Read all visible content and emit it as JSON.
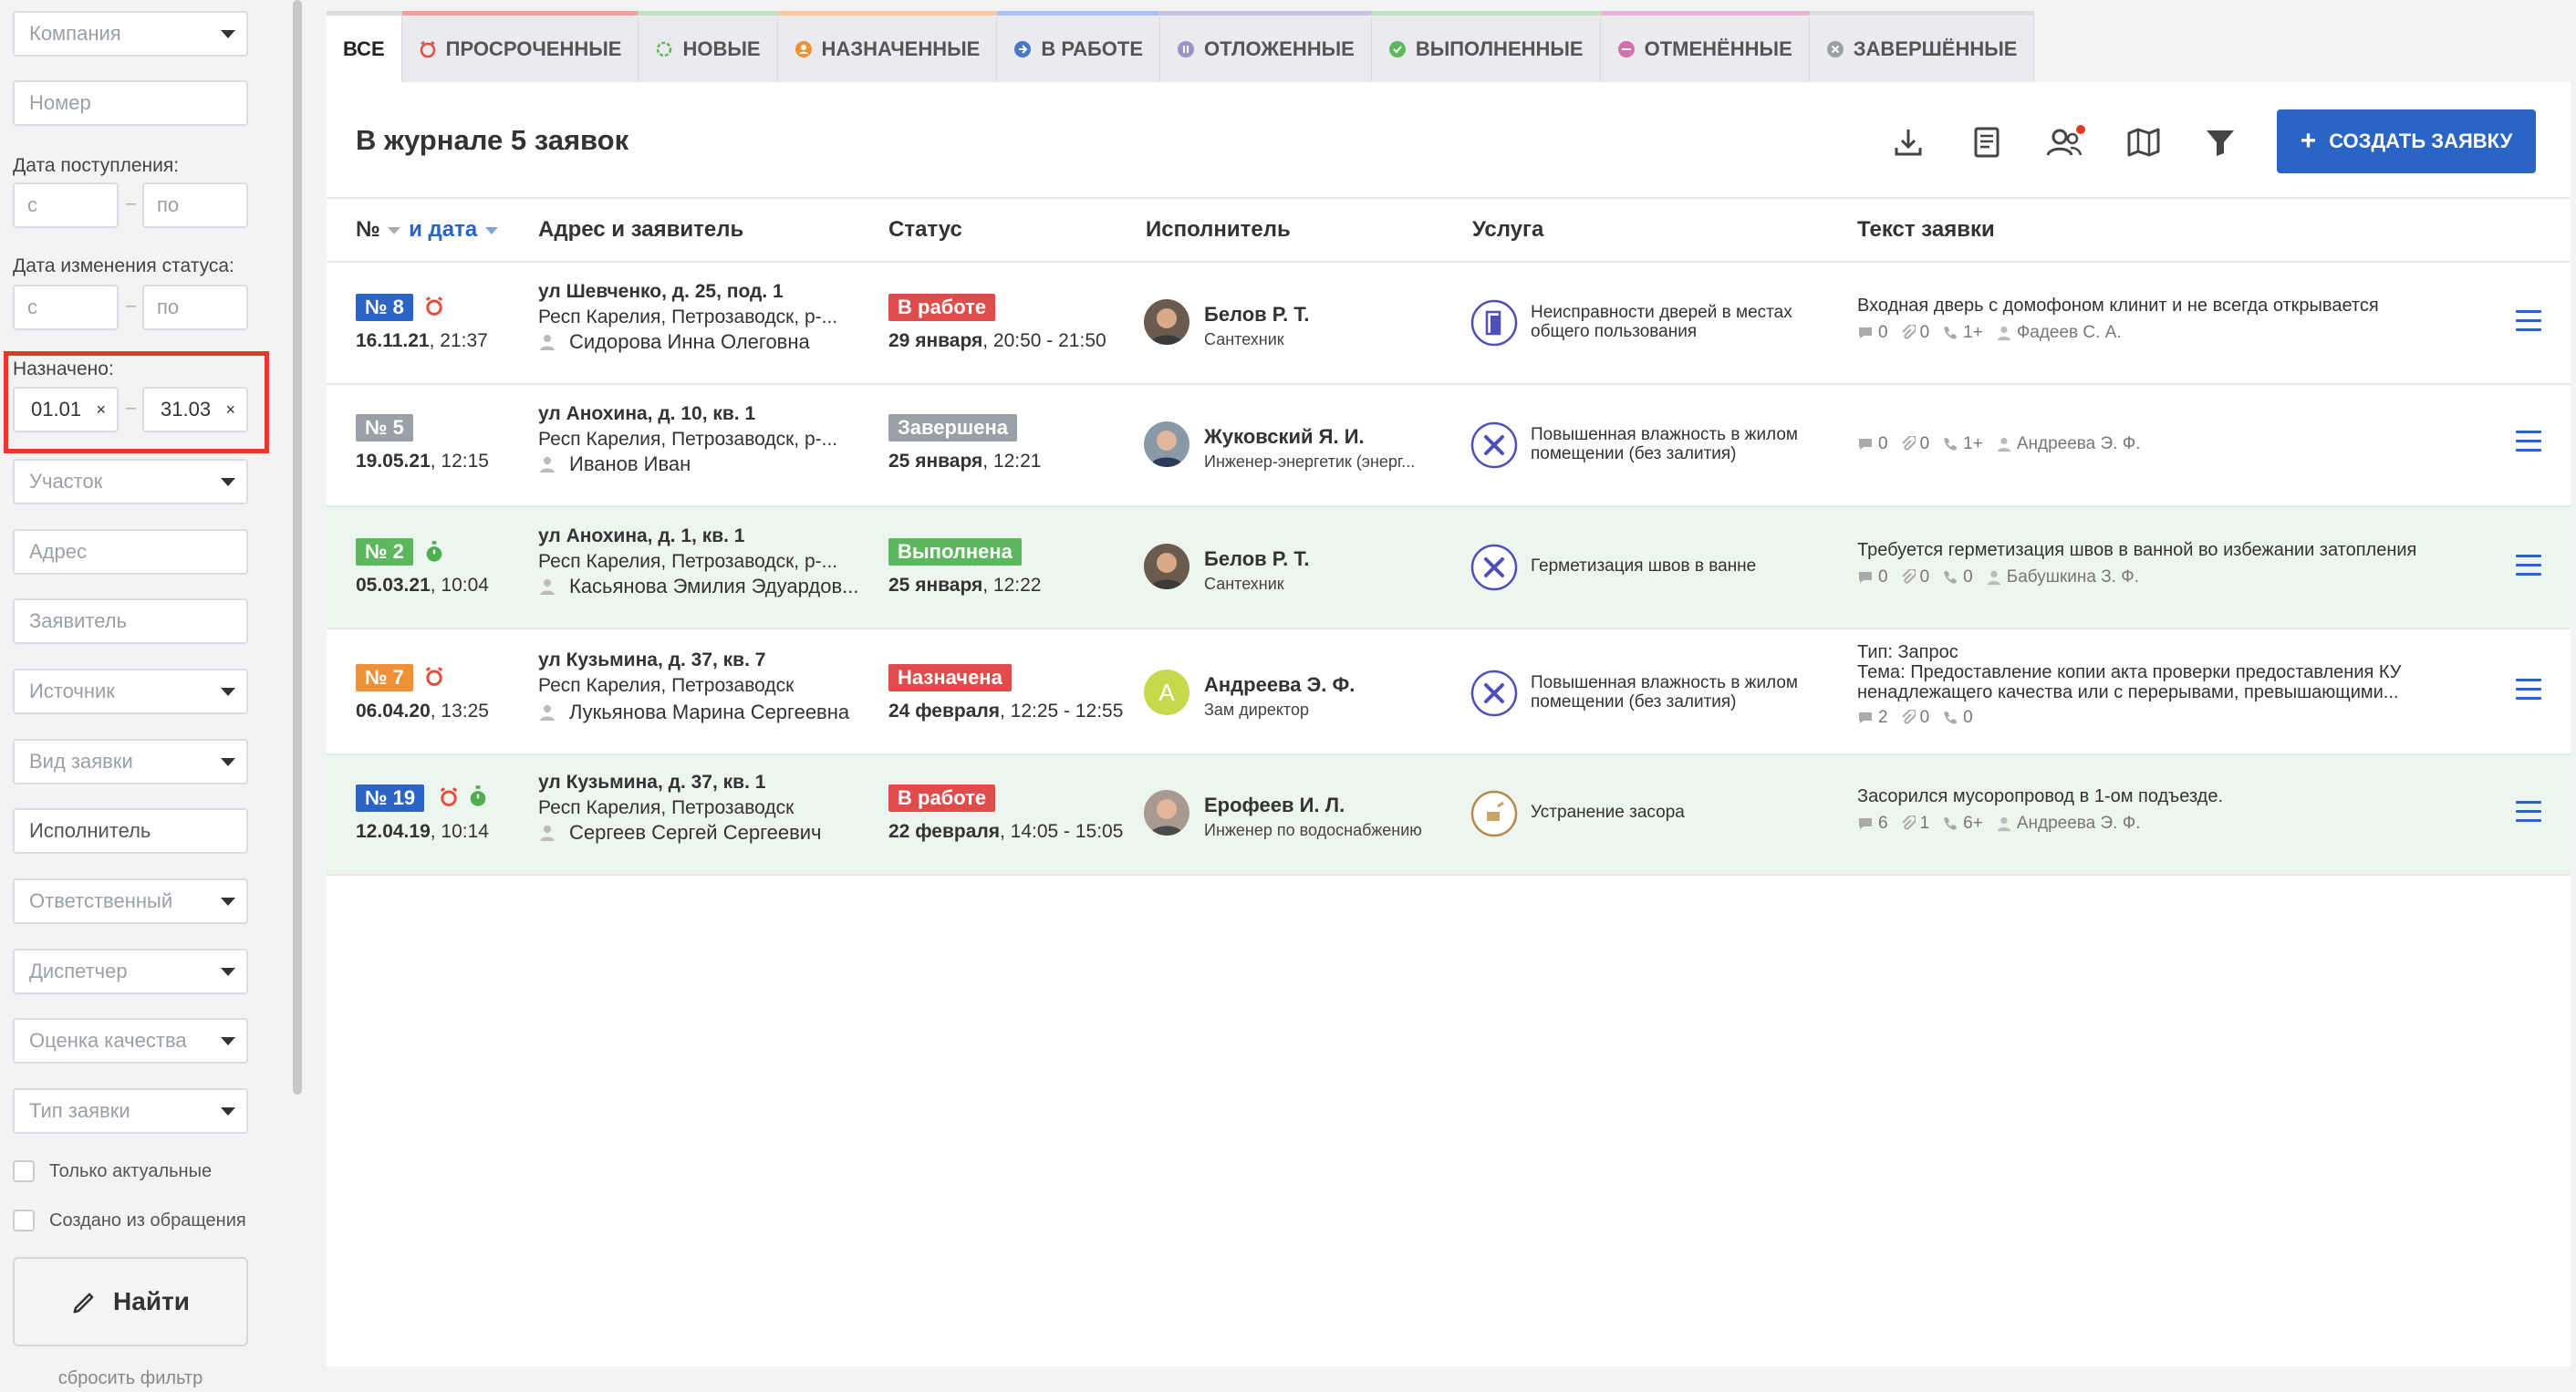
{
  "sidebar": {
    "company_placeholder": "Компания",
    "number_placeholder": "Номер",
    "date_received_label": "Дата поступления:",
    "from_placeholder": "с",
    "to_placeholder": "по",
    "status_change_label": "Дата изменения статуса:",
    "assigned_label": "Назначено:",
    "assigned_from": "01.01",
    "assigned_to": "31.03",
    "clear_symbol": "×",
    "area_placeholder": "Участок",
    "address_placeholder": "Адрес",
    "applicant_placeholder": "Заявитель",
    "source_placeholder": "Источник",
    "request_kind_placeholder": "Вид заявки",
    "executor_placeholder": "Исполнитель",
    "responsible_placeholder": "Ответственный",
    "dispatcher_placeholder": "Диспетчер",
    "quality_placeholder": "Оценка качества",
    "request_type_placeholder": "Тип заявки",
    "only_actual_label": "Только актуальные",
    "from_appeal_label": "Создано из обращения",
    "find_label": "Найти",
    "reset_label": "сбросить фильтр"
  },
  "tabs": [
    {
      "label": "ВСЕ",
      "color": "#dddddd"
    },
    {
      "label": "ПРОСРОЧЕННЫЕ",
      "color": "#f4a09a"
    },
    {
      "label": "НОВЫЕ",
      "color": "#bfe3bf"
    },
    {
      "label": "НАЗНАЧЕННЫЕ",
      "color": "#f7c8a0"
    },
    {
      "label": "В РАБОТЕ",
      "color": "#a9c3ec"
    },
    {
      "label": "ОТЛОЖЕННЫЕ",
      "color": "#c8c4e6"
    },
    {
      "label": "ВЫПОЛНЕННЫЕ",
      "color": "#bfe3bf"
    },
    {
      "label": "ОТМЕНЁННЫЕ",
      "color": "#e8b4d8"
    },
    {
      "label": "ЗАВЕРШЁННЫЕ",
      "color": "#dddddd"
    }
  ],
  "panel": {
    "title": "В журнале 5 заявок",
    "create_label": "СОЗДАТЬ ЗАЯВКУ"
  },
  "columns": {
    "num": "№",
    "and_date": "и дата",
    "address": "Адрес и заявитель",
    "status": "Статус",
    "executor": "Исполнитель",
    "service": "Услуга",
    "text": "Текст заявки"
  },
  "rows": [
    {
      "number": "№ 8",
      "badge_color": "#2a64c5",
      "date_bold": "16.11.21",
      "time": ", 21:37",
      "street": "ул Шевченко, д. 25, под. 1",
      "city": "Респ Карелия, Петрозаводск, р-...",
      "applicant": "Сидорова Инна Олеговна",
      "status": "В работе",
      "status_color": "#e24b4b",
      "status_date": "29 января",
      "status_time": ", 20:50 - 21:50",
      "executor": "Белов Р. Т.",
      "role": "Сантехник",
      "service": "Неисправности дверей в местах общего пользования",
      "text": "Входная дверь с домофоном клинит и не всегда открывается",
      "comments": "0",
      "files": "0",
      "calls": "1+",
      "author": "Фадеев С. А."
    },
    {
      "number": "№ 5",
      "badge_color": "#9aa0a6",
      "date_bold": "19.05.21",
      "time": ", 12:15",
      "street": "ул Анохина, д. 10, кв. 1",
      "city": "Респ Карелия, Петрозаводск, р-...",
      "applicant": "Иванов Иван",
      "status": "Завершена",
      "status_color": "#9aa0a6",
      "status_date": "25 января",
      "status_time": ", 12:21",
      "executor": "Жуковский Я. И.",
      "role": "Инженер-энергетик (энерг...",
      "service": "Повышенная влажность в жилом помещении (без залития)",
      "text": "",
      "comments": "0",
      "files": "0",
      "calls": "1+",
      "author": "Андреева Э. Ф."
    },
    {
      "number": "№ 2",
      "badge_color": "#5cb85c",
      "date_bold": "05.03.21",
      "time": ", 10:04",
      "street": "ул Анохина, д. 1, кв. 1",
      "city": "Респ Карелия, Петрозаводск, р-...",
      "applicant": "Касьянова Эмилия Эдуардов...",
      "status": "Выполнена",
      "status_color": "#5cb85c",
      "status_date": "25 января",
      "status_time": ", 12:22",
      "executor": "Белов Р. Т.",
      "role": "Сантехник",
      "service": "Герметизация швов в ванне",
      "text": "Требуется герметизация швов в ванной во избежании затопления",
      "comments": "0",
      "files": "0",
      "calls": "0",
      "author": "Бабушкина З. Ф."
    },
    {
      "number": "№ 7",
      "badge_color": "#f0913a",
      "date_bold": "06.04.20",
      "time": ", 13:25",
      "street": "ул Кузьмина, д. 37, кв. 7",
      "city": "Респ Карелия, Петрозаводск",
      "applicant": "Лукьянова Марина Сергеевна",
      "status": "Назначена",
      "status_color": "#e24b4b",
      "status_date": "24 февраля",
      "status_time": ", 12:25 - 12:55",
      "executor": "Андреева Э. Ф.",
      "role": "Зам директор",
      "avatar_letter": "А",
      "service": "Повышенная влажность в жилом помещении (без залития)",
      "text_type": "Тип: Запрос",
      "text": "Тема: Предоставление копии акта проверки предоставления КУ ненадлежащего качества или с перерывами, превышающими...",
      "comments": "2",
      "files": "0",
      "calls": "0",
      "author": ""
    },
    {
      "number": "№ 19",
      "badge_color": "#2a64c5",
      "date_bold": "12.04.19",
      "time": ", 10:14",
      "street": "ул Кузьмина, д. 37, кв. 1",
      "city": "Респ Карелия, Петрозаводск",
      "applicant": "Сергеев Сергей Сергеевич",
      "status": "В работе",
      "status_color": "#e24b4b",
      "status_date": "22 февраля",
      "status_time": ", 14:05 - 15:05",
      "executor": "Ерофеев И. Л.",
      "role": "Инженер по водоснабжению",
      "service": "Устранение засора",
      "text": "Засорился мусоропровод в 1-ом подъезде.",
      "comments": "6",
      "files": "1",
      "calls": "6+",
      "author": "Андреева Э. Ф."
    }
  ]
}
